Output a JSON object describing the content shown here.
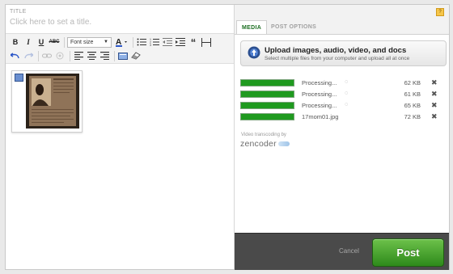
{
  "editor": {
    "title_label": "TITLE",
    "title_placeholder": "Click here to set a title.",
    "font_size_label": "Font size"
  },
  "tabs": [
    {
      "label": "MEDIA",
      "active": true
    },
    {
      "label": "POST OPTIONS",
      "active": false
    }
  ],
  "upload": {
    "title": "Upload images, audio, video, and docs",
    "subtitle": "Select multiple files from your computer and upload all at once"
  },
  "files": [
    {
      "name": "Processing...",
      "size": "62 KB",
      "processing": true,
      "progress": 1.0
    },
    {
      "name": "Processing...",
      "size": "61 KB",
      "processing": true,
      "progress": 1.0
    },
    {
      "name": "Processing...",
      "size": "65 KB",
      "processing": true,
      "progress": 1.0
    },
    {
      "name": "17mom01.jpg",
      "size": "72 KB",
      "processing": false,
      "progress": 1.0
    }
  ],
  "transcoding": {
    "label": "Video transcoding by",
    "brand": "zencoder"
  },
  "footer": {
    "cancel_label": "Cancel",
    "post_label": "Post"
  },
  "colors": {
    "accent_green": "#1f9a1f",
    "footer_bg": "#4a4a4a"
  }
}
